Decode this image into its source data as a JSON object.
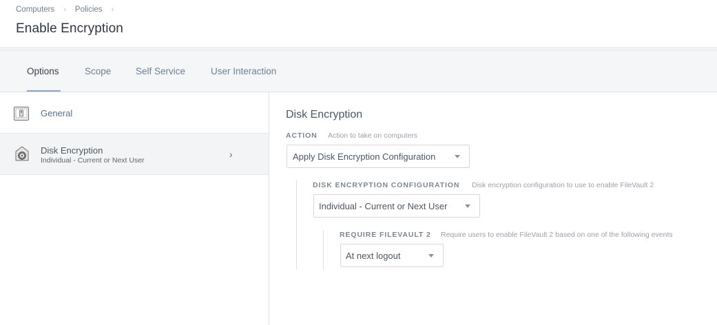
{
  "breadcrumb": {
    "items": [
      "Computers",
      "Policies"
    ],
    "separator": "›"
  },
  "page": {
    "title": "Enable Encryption"
  },
  "tabs": [
    {
      "label": "Options",
      "active": true
    },
    {
      "label": "Scope",
      "active": false
    },
    {
      "label": "Self Service",
      "active": false
    },
    {
      "label": "User Interaction",
      "active": false
    }
  ],
  "sidebar": {
    "items": [
      {
        "label": "General",
        "sublabel": "",
        "icon": "general-icon",
        "selected": false
      },
      {
        "label": "Disk Encryption",
        "sublabel": "Individual - Current or Next User",
        "icon": "disk-encryption-icon",
        "selected": true
      }
    ],
    "chevron": "›"
  },
  "main": {
    "section_title": "Disk Encryption",
    "action": {
      "label": "ACTION",
      "hint": "Action to take on computers",
      "value": "Apply Disk Encryption Configuration"
    },
    "configuration": {
      "label": "DISK ENCRYPTION CONFIGURATION",
      "hint": "Disk encryption configuration to use to enable FileVault 2",
      "value": "Individual - Current or Next User"
    },
    "require": {
      "label": "REQUIRE FILEVAULT 2",
      "hint": "Require users to enable FileVault 2 based on one of the following events",
      "value": "At next logout"
    }
  },
  "colors": {
    "accent": "#8fa4c4",
    "link": "#6e7f94",
    "selected_bg": "#f3f4f6",
    "tabbar_bg": "#f5f6f8"
  }
}
